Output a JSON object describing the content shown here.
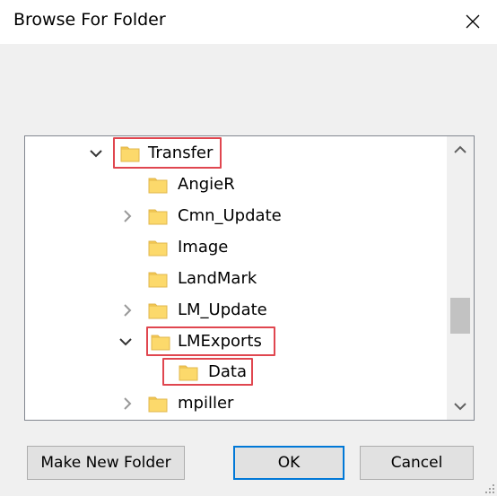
{
  "window": {
    "title": "Browse For Folder",
    "close_icon": "close-icon"
  },
  "tree": {
    "items": [
      {
        "label": "Transfer",
        "expander": "expanded",
        "highlight": true
      },
      {
        "label": "AngieR",
        "expander": "none",
        "highlight": false
      },
      {
        "label": "Cmn_Update",
        "expander": "collapsed",
        "highlight": false
      },
      {
        "label": "Image",
        "expander": "none",
        "highlight": false
      },
      {
        "label": "LandMark",
        "expander": "none",
        "highlight": false
      },
      {
        "label": "LM_Update",
        "expander": "collapsed",
        "highlight": false
      },
      {
        "label": "LMExports",
        "expander": "expanded",
        "highlight": true
      },
      {
        "label": "Data",
        "expander": "none",
        "highlight": true
      },
      {
        "label": "mpiller",
        "expander": "collapsed",
        "highlight": false
      }
    ]
  },
  "buttons": {
    "make_new_folder": "Make New Folder",
    "ok": "OK",
    "cancel": "Cancel"
  },
  "colors": {
    "highlight_border": "#e0464f",
    "folder_yellow": "#fcd96b",
    "default_button_border": "#0078d7"
  }
}
